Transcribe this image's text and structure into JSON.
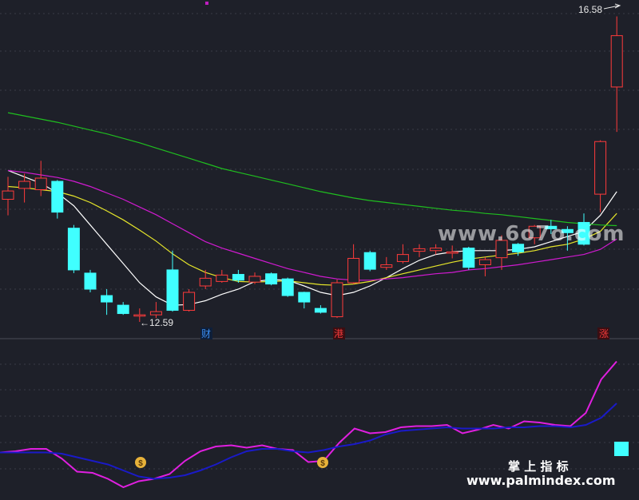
{
  "chart_data": [
    {
      "type": "candlestick",
      "candles": [
        {
          "o": 14.5,
          "c": 14.63,
          "h": 14.85,
          "l": 14.25
        },
        {
          "o": 14.67,
          "c": 14.78,
          "h": 14.9,
          "l": 14.45
        },
        {
          "o": 14.65,
          "c": 14.83,
          "h": 15.1,
          "l": 14.55
        },
        {
          "o": 14.78,
          "c": 14.3,
          "h": 14.8,
          "l": 14.2
        },
        {
          "o": 14.05,
          "c": 13.4,
          "h": 14.1,
          "l": 13.35
        },
        {
          "o": 13.35,
          "c": 13.1,
          "h": 13.4,
          "l": 13.05
        },
        {
          "o": 13.0,
          "c": 12.9,
          "h": 13.1,
          "l": 12.7
        },
        {
          "o": 12.85,
          "c": 12.72,
          "h": 12.9,
          "l": 12.7
        },
        {
          "o": 12.68,
          "c": 12.7,
          "h": 12.8,
          "l": 12.59
        },
        {
          "o": 12.7,
          "c": 12.75,
          "h": 12.9,
          "l": 12.65
        },
        {
          "o": 13.4,
          "c": 12.77,
          "h": 13.7,
          "l": 12.75
        },
        {
          "o": 12.77,
          "c": 13.05,
          "h": 13.1,
          "l": 12.75
        },
        {
          "o": 13.15,
          "c": 13.27,
          "h": 13.4,
          "l": 13.1
        },
        {
          "o": 13.22,
          "c": 13.32,
          "h": 13.4,
          "l": 13.2
        },
        {
          "o": 13.33,
          "c": 13.24,
          "h": 13.4,
          "l": 13.2
        },
        {
          "o": 13.21,
          "c": 13.3,
          "h": 13.36,
          "l": 13.18
        },
        {
          "o": 13.34,
          "c": 13.18,
          "h": 13.36,
          "l": 13.16
        },
        {
          "o": 13.26,
          "c": 13.0,
          "h": 13.28,
          "l": 12.98
        },
        {
          "o": 13.05,
          "c": 12.9,
          "h": 13.06,
          "l": 12.8
        },
        {
          "o": 12.8,
          "c": 12.74,
          "h": 12.85,
          "l": 12.72
        },
        {
          "o": 12.67,
          "c": 13.2,
          "h": 13.25,
          "l": 12.65
        },
        {
          "o": 13.2,
          "c": 13.58,
          "h": 13.8,
          "l": 13.18
        },
        {
          "o": 13.67,
          "c": 13.41,
          "h": 13.7,
          "l": 13.38
        },
        {
          "o": 13.44,
          "c": 13.48,
          "h": 13.6,
          "l": 13.4
        },
        {
          "o": 13.53,
          "c": 13.64,
          "h": 13.8,
          "l": 13.5
        },
        {
          "o": 13.69,
          "c": 13.73,
          "h": 13.8,
          "l": 13.6
        },
        {
          "o": 13.7,
          "c": 13.74,
          "h": 13.8,
          "l": 13.64
        },
        {
          "o": 13.66,
          "c": 13.68,
          "h": 13.78,
          "l": 13.58
        },
        {
          "o": 13.74,
          "c": 13.44,
          "h": 13.76,
          "l": 13.4
        },
        {
          "o": 13.48,
          "c": 13.56,
          "h": 13.6,
          "l": 13.3
        },
        {
          "o": 13.59,
          "c": 13.86,
          "h": 13.94,
          "l": 13.4
        },
        {
          "o": 13.8,
          "c": 13.68,
          "h": 13.82,
          "l": 13.62
        },
        {
          "o": 13.9,
          "c": 14.08,
          "h": 14.1,
          "l": 13.8
        },
        {
          "o": 14.08,
          "c": 14.04,
          "h": 14.18,
          "l": 13.96
        },
        {
          "o": 14.03,
          "c": 13.98,
          "h": 14.08,
          "l": 13.7
        },
        {
          "o": 14.14,
          "c": 13.8,
          "h": 14.28,
          "l": 13.78
        },
        {
          "o": 14.58,
          "c": 15.4,
          "h": 15.42,
          "l": 14.3
        },
        {
          "o": 16.25,
          "c": 17.05,
          "h": 17.35,
          "l": 15.55
        }
      ],
      "moving_averages": [
        {
          "color": "#ffffff",
          "values": [
            14.95,
            14.85,
            14.75,
            14.6,
            14.4,
            14.1,
            13.8,
            13.5,
            13.2,
            12.98,
            12.85,
            12.86,
            12.92,
            13.02,
            13.1,
            13.22,
            13.25,
            13.24,
            13.15,
            13.05,
            13.0,
            13.05,
            13.15,
            13.28,
            13.42,
            13.55,
            13.64,
            13.68,
            13.7,
            13.7,
            13.7,
            13.72,
            13.76,
            13.84,
            13.92,
            14.0,
            14.25,
            14.62
          ]
        },
        {
          "color": "#e6e62a",
          "values": [
            14.7,
            14.68,
            14.65,
            14.62,
            14.55,
            14.45,
            14.32,
            14.18,
            14.02,
            13.85,
            13.65,
            13.48,
            13.36,
            13.28,
            13.22,
            13.21,
            13.22,
            13.23,
            13.2,
            13.17,
            13.16,
            13.18,
            13.22,
            13.28,
            13.34,
            13.4,
            13.46,
            13.52,
            13.57,
            13.6,
            13.63,
            13.66,
            13.7,
            13.76,
            13.8,
            13.88,
            14.0,
            14.28
          ]
        },
        {
          "color": "#d01ad0",
          "values": [
            14.95,
            14.92,
            14.88,
            14.84,
            14.78,
            14.7,
            14.6,
            14.5,
            14.38,
            14.26,
            14.12,
            13.98,
            13.84,
            13.74,
            13.66,
            13.58,
            13.5,
            13.42,
            13.36,
            13.3,
            13.26,
            13.24,
            13.24,
            13.26,
            13.28,
            13.31,
            13.34,
            13.36,
            13.4,
            13.42,
            13.45,
            13.48,
            13.52,
            13.56,
            13.6,
            13.64,
            13.72,
            13.88
          ]
        },
        {
          "color": "#1fbe1f",
          "values": [
            15.85,
            15.8,
            15.75,
            15.7,
            15.64,
            15.58,
            15.52,
            15.45,
            15.38,
            15.3,
            15.22,
            15.14,
            15.06,
            14.98,
            14.92,
            14.86,
            14.8,
            14.74,
            14.68,
            14.62,
            14.57,
            14.52,
            14.48,
            14.45,
            14.42,
            14.39,
            14.36,
            14.33,
            14.31,
            14.28,
            14.26,
            14.23,
            14.2,
            14.17,
            14.14,
            14.12,
            14.1,
            14.09
          ]
        }
      ],
      "annotations": {
        "low_label": "←12.59",
        "high_label": "16.58"
      },
      "markers": [
        "财",
        "港",
        "涨"
      ]
    },
    {
      "type": "line",
      "series": [
        {
          "color": "#e01fe0",
          "values": [
            -0.05,
            0.0,
            0.1,
            0.1,
            -0.3,
            -0.85,
            -0.9,
            -1.15,
            -1.5,
            -1.25,
            -1.15,
            -0.95,
            -0.4,
            0.0,
            0.2,
            0.25,
            0.15,
            0.25,
            0.1,
            0.05,
            -0.45,
            -0.4,
            0.35,
            0.95,
            0.75,
            0.8,
            1.0,
            1.05,
            1.05,
            1.1,
            0.75,
            0.9,
            1.1,
            0.95,
            1.25,
            1.2,
            1.1,
            1.05,
            1.6,
            3.0,
            3.75
          ]
        },
        {
          "color": "#1a1ac8",
          "values": [
            -0.05,
            -0.05,
            -0.05,
            -0.05,
            -0.1,
            -0.25,
            -0.4,
            -0.55,
            -0.8,
            -1.05,
            -1.15,
            -1.1,
            -1.0,
            -0.8,
            -0.55,
            -0.25,
            0.0,
            0.1,
            0.1,
            0.0,
            -0.05,
            0.05,
            0.2,
            0.3,
            0.45,
            0.7,
            0.85,
            0.9,
            0.95,
            1.0,
            0.95,
            0.95,
            0.95,
            1.0,
            1.0,
            1.05,
            1.05,
            1.0,
            1.1,
            1.4,
            2.0
          ]
        }
      ],
      "markers": [
        "$",
        "$"
      ]
    }
  ],
  "watermarks": {
    "center": "www.6o7o.com",
    "footer_title": "掌 上 指 标",
    "footer_url": "www.palmindex.com"
  }
}
